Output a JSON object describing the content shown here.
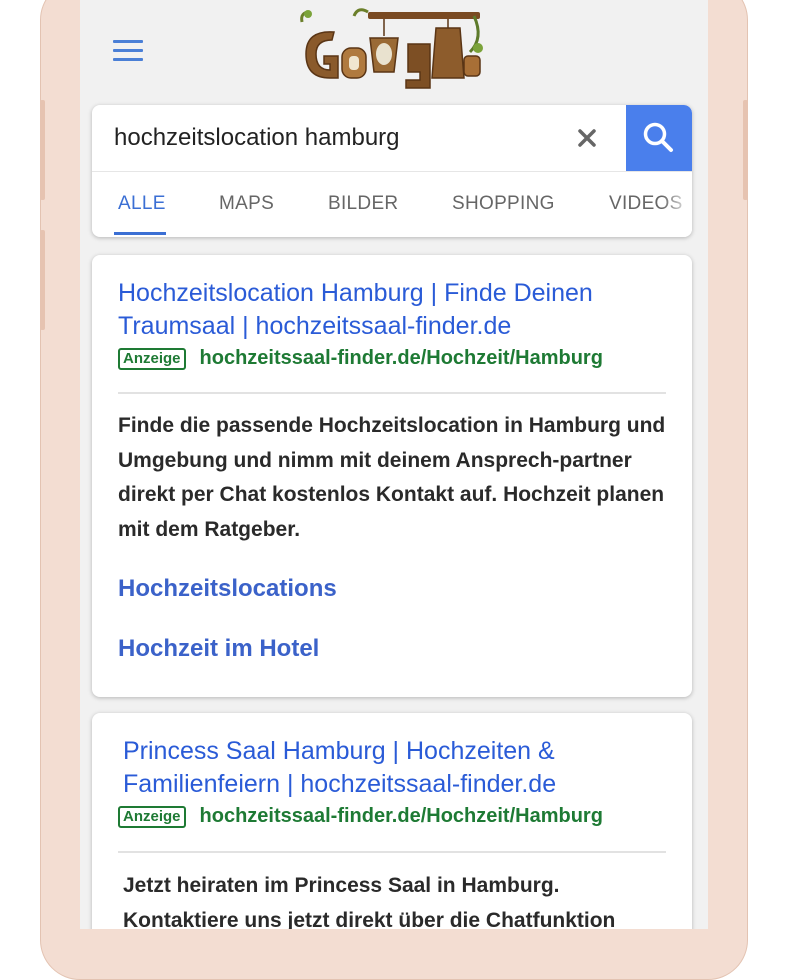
{
  "header": {
    "menu_icon": "hamburger-menu-icon",
    "doodle_icon": "google-doodle-logo",
    "doodle_letters": [
      "G",
      "o",
      "g"
    ]
  },
  "search": {
    "query": "hochzeitslocation hamburg",
    "clear_icon": "close-icon",
    "search_icon": "search-icon",
    "accent_color": "#4a7fec"
  },
  "tabs": [
    "ALLE",
    "MAPS",
    "BILDER",
    "SHOPPING",
    "VIDEOS"
  ],
  "active_tab": "ALLE",
  "results": [
    {
      "title": "Hochzeitslocation Hamburg | Finde Deinen Traumsaal | hochzeitssaal-finder.de",
      "badge": "Anzeige",
      "url": "hochzeitssaal-finder.de/Hochzeit/Hamburg",
      "description": "Finde die passende Hochzeitslocation in Hamburg und Umgebung und nimm mit deinem Ansprech-partner direkt per Chat kostenlos Kontakt auf. Hochzeit planen mit dem Ratgeber.",
      "sitelinks": [
        "Hochzeitslocations",
        "Hochzeit im Hotel"
      ]
    },
    {
      "title": "Princess Saal Hamburg | Hochzeiten & Familienfeiern | hochzeitssaal-finder.de",
      "badge": "Anzeige",
      "url": "hochzeitssaal-finder.de/Hochzeit/Hamburg",
      "description": "Jetzt heiraten im Princess Saal in Hamburg. Kontaktiere uns jetzt direkt über die Chatfunktion"
    }
  ],
  "colors": {
    "link_blue": "#2a5bd7",
    "url_green": "#1e7a34",
    "phone_frame": "#f3ddd2"
  }
}
